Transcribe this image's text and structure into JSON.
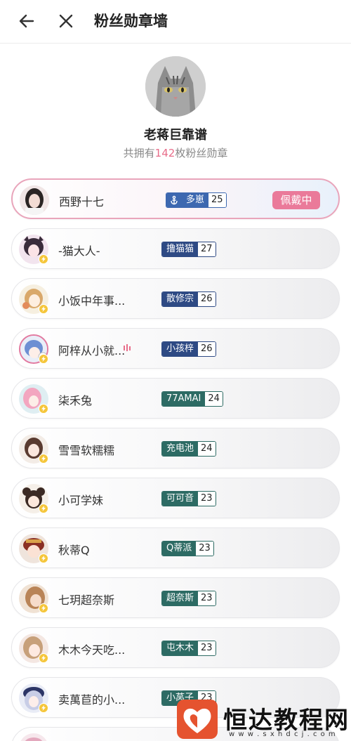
{
  "header": {
    "title": "粉丝勋章墙"
  },
  "profile": {
    "name": "老蒋巨靠谱",
    "stat_prefix": "共拥有",
    "stat_count": "142",
    "stat_suffix": "枚粉丝勋章"
  },
  "rows": [
    {
      "name": "西野十七",
      "badge": "多崽",
      "level": "25",
      "status": "佩戴中"
    },
    {
      "name": "-猫大人-",
      "badge": "撸猫猫",
      "level": "27"
    },
    {
      "name": "小饭中年事...",
      "badge": "散修宗",
      "level": "26"
    },
    {
      "name": "阿梓从小就...",
      "badge": "小孩梓",
      "level": "26"
    },
    {
      "name": "柒禾兔",
      "badge": "77AMAI",
      "level": "24"
    },
    {
      "name": "雪雪软糯糯",
      "badge": "充电池",
      "level": "24"
    },
    {
      "name": "小可学妹",
      "badge": "可可音",
      "level": "23"
    },
    {
      "name": "秋蒂Q",
      "badge": "Q蒂派",
      "level": "23"
    },
    {
      "name": "七玥超奈斯",
      "badge": "超奈斯",
      "level": "23"
    },
    {
      "name": "木木今天吃...",
      "badge": "屯木木",
      "level": "23"
    },
    {
      "name": "卖萬苣的小...",
      "badge": "小莴子",
      "level": "23"
    }
  ],
  "watermark": {
    "text": "恒达教程网",
    "url": "w w w . s x h d c j . c o m"
  },
  "colors": {
    "accent_pink": "#ea7a9a",
    "badge_blue": "#2e4a84",
    "badge_green": "#2d6b64"
  }
}
